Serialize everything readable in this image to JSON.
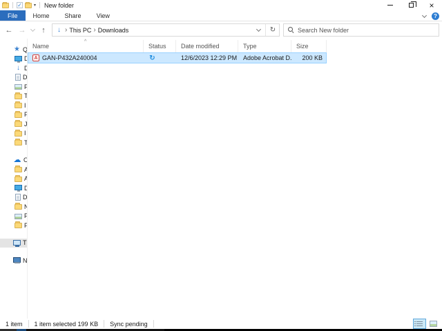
{
  "colors": {
    "filetab_bg": "#2b6dbd",
    "help_blue": "#2d7dd2",
    "selection_bg": "#cce8ff",
    "selection_border": "#99d1ff",
    "sync_blue": "#2490e0"
  },
  "titlebar": {
    "title": "New folder",
    "controls": {
      "minimize": "minimize",
      "restore": "restore",
      "close": "×"
    }
  },
  "ribbon": {
    "tabs": [
      "File",
      "Home",
      "Share",
      "View"
    ],
    "active": "File"
  },
  "toolbar": {
    "back": "←",
    "forward": "→",
    "up": "↑",
    "refresh": "↻",
    "crumbs": [
      "This PC",
      "Downloads"
    ],
    "crumb_icon": "downloads",
    "search_placeholder": "Search New folder"
  },
  "sidebar": {
    "items": [
      {
        "icon": "star",
        "label": "Quick access",
        "level": 0
      },
      {
        "icon": "desktop",
        "label": "Desktop",
        "level": 1
      },
      {
        "icon": "downloads",
        "label": "Downloads",
        "level": 1
      },
      {
        "icon": "document",
        "label": "Documents",
        "level": 1
      },
      {
        "icon": "pictures",
        "label": "Pictures",
        "level": 1
      },
      {
        "icon": "folder",
        "label": "T",
        "level": 1
      },
      {
        "icon": "folder",
        "label": "I",
        "level": 1
      },
      {
        "icon": "folder",
        "label": "F",
        "level": 1
      },
      {
        "icon": "folder",
        "label": "J",
        "level": 1
      },
      {
        "icon": "folder",
        "label": "I",
        "level": 1
      },
      {
        "icon": "folder",
        "label": "T",
        "level": 1
      },
      {
        "gap": true
      },
      {
        "icon": "onedrive",
        "label": "OneDrive",
        "level": 0
      },
      {
        "icon": "folder",
        "label": "A",
        "level": 1
      },
      {
        "icon": "folder",
        "label": "A",
        "level": 1
      },
      {
        "icon": "desktop",
        "label": "Desktop",
        "level": 1
      },
      {
        "icon": "document",
        "label": "Documents",
        "level": 1
      },
      {
        "icon": "folder",
        "label": "N",
        "level": 1
      },
      {
        "icon": "pictures",
        "label": "Pictures",
        "level": 1
      },
      {
        "icon": "folder",
        "label": "P",
        "level": 1
      },
      {
        "gap": true
      },
      {
        "icon": "thispc",
        "label": "This PC",
        "level": 0,
        "selected": true
      },
      {
        "gap": true
      },
      {
        "icon": "network",
        "label": "Network",
        "level": 0
      }
    ]
  },
  "filelist": {
    "columns": [
      {
        "label": "Name",
        "width": 168
      },
      {
        "label": "Status",
        "width": 47
      },
      {
        "label": "Date modified",
        "width": 90
      },
      {
        "label": "Type",
        "width": 77
      },
      {
        "label": "Size",
        "width": 51
      }
    ],
    "sort_caret": "^",
    "rows": [
      {
        "icon": "pdf",
        "name": "GAN-P432A240004",
        "status_icon": "sync",
        "date": "12/6/2023 12:29 PM",
        "type": "Adobe Acrobat D...",
        "size": "200 KB",
        "selected": true
      }
    ]
  },
  "statusbar": {
    "segments": [
      "1 item",
      "1 item selected  199 KB",
      "Sync pending"
    ]
  }
}
